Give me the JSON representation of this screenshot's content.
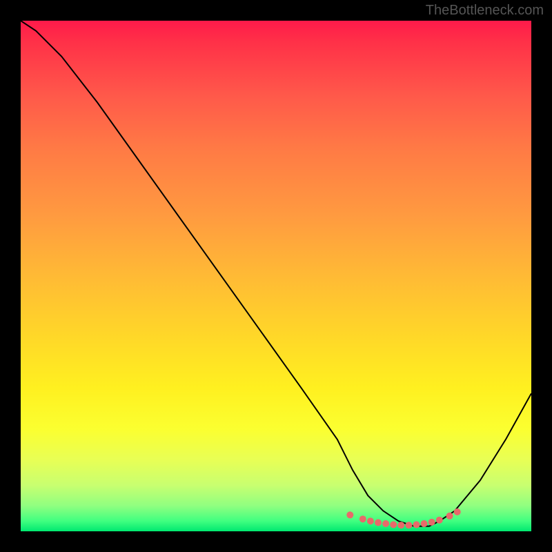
{
  "watermark": "TheBottleneck.com",
  "chart_data": {
    "type": "line",
    "title": "",
    "xlabel": "",
    "ylabel": "",
    "xlim": [
      0,
      100
    ],
    "ylim": [
      0,
      100
    ],
    "grid": false,
    "series": [
      {
        "name": "bottleneck-curve",
        "x": [
          0,
          3,
          8,
          15,
          25,
          35,
          45,
          55,
          62,
          65,
          68,
          71,
          74,
          77,
          80,
          82,
          85,
          90,
          95,
          100
        ],
        "y": [
          100,
          98,
          93,
          84,
          70,
          56,
          42,
          28,
          18,
          12,
          7,
          4,
          2,
          1,
          1,
          2,
          4,
          10,
          18,
          27
        ]
      }
    ],
    "markers": {
      "name": "highlight-points",
      "x": [
        64.5,
        67,
        68.5,
        70,
        71.5,
        73,
        74.5,
        76,
        77.5,
        79,
        80.5,
        82,
        84,
        85.5
      ],
      "y": [
        3.2,
        2.4,
        2.0,
        1.7,
        1.5,
        1.3,
        1.2,
        1.2,
        1.3,
        1.5,
        1.8,
        2.2,
        3.0,
        3.8
      ]
    },
    "colors": {
      "curve": "#000000",
      "markers": "#e86a6a",
      "gradient_top": "#ff1a4a",
      "gradient_mid": "#ffd828",
      "gradient_bottom": "#00e870"
    }
  }
}
